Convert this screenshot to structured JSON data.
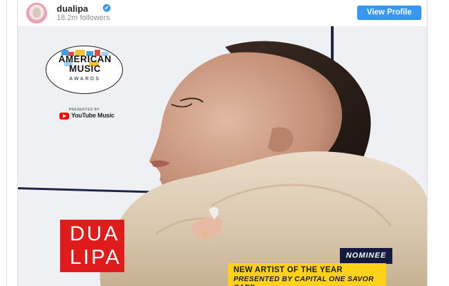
{
  "profile": {
    "username": "dualipa",
    "verified_mark": "✔",
    "followers": "18.2m followers",
    "view_profile_label": "View Profile"
  },
  "post": {
    "logo": {
      "title_line1": "AMERICAN",
      "title_line2": "MUSIC",
      "subtitle": "AWARDS",
      "presented_by": "PRESENTED BY",
      "sponsor": "YouTube Music"
    },
    "artist_name_line1": "DUA",
    "artist_name_line2": "LIPA",
    "badge": "NOMINEE",
    "category_line1": "NEW ARTIST OF THE YEAR",
    "category_line2": "PRESENTED BY CAPITAL ONE SAVOR CARD"
  },
  "icons": [
    "avatar",
    "verified-badge-icon",
    "youtube-icon"
  ],
  "colors": {
    "accent": "#3897f0",
    "name_box": "#e01b1b",
    "award_box": "#ffd21a",
    "nominee_box": "#141a3f"
  }
}
